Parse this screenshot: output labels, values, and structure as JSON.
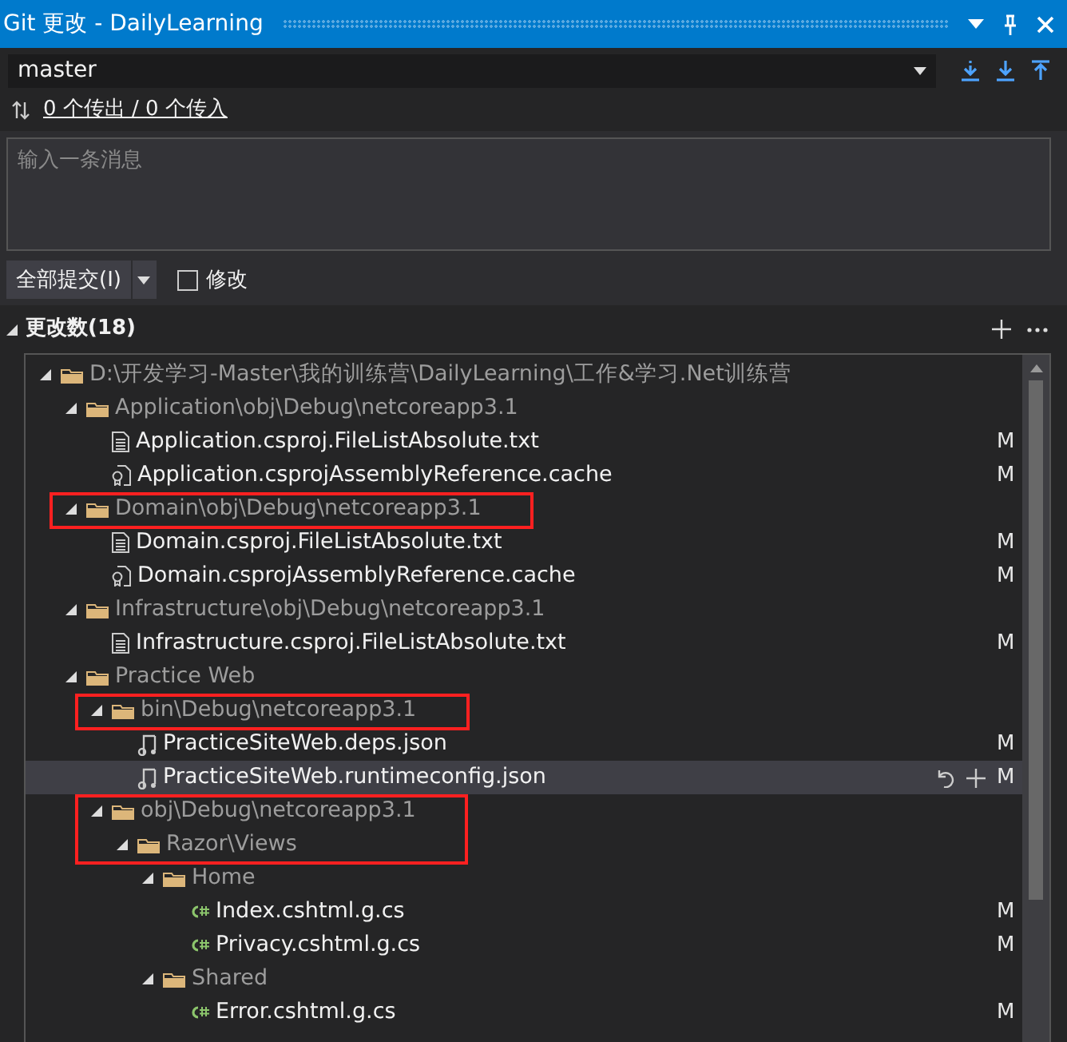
{
  "window": {
    "title": "Git 更改 - DailyLearning"
  },
  "branch": {
    "value": "master"
  },
  "sync": {
    "link": "0 个传出 / 0 个传入"
  },
  "message": {
    "placeholder": "输入一条消息"
  },
  "commit": {
    "button": "全部提交(I)",
    "amend": {
      "label": "修改",
      "checked": false
    }
  },
  "changes": {
    "header": "更改数(18)",
    "expanded": true,
    "tree": [
      {
        "label": "D:\\开发学习-Master\\我的训练营\\DailyLearning\\工作&学习.Net训练营",
        "kind": "folder",
        "expanded": true,
        "children": [
          {
            "label": "Application\\obj\\Debug\\netcoreapp3.1",
            "kind": "folder",
            "expanded": true,
            "children": [
              {
                "label": "Application.csproj.FileListAbsolute.txt",
                "kind": "text",
                "status": "M",
                "selected": false
              },
              {
                "label": "Application.csprojAssemblyReference.cache",
                "kind": "reference",
                "status": "M",
                "selected": false
              }
            ]
          },
          {
            "label": "Domain\\obj\\Debug\\netcoreapp3.1",
            "kind": "folder",
            "expanded": true,
            "highlighted": true,
            "children": [
              {
                "label": "Domain.csproj.FileListAbsolute.txt",
                "kind": "text",
                "status": "M",
                "selected": false
              },
              {
                "label": "Domain.csprojAssemblyReference.cache",
                "kind": "reference",
                "status": "M",
                "selected": false
              }
            ]
          },
          {
            "label": "Infrastructure\\obj\\Debug\\netcoreapp3.1",
            "kind": "folder",
            "expanded": true,
            "children": [
              {
                "label": "Infrastructure.csproj.FileListAbsolute.txt",
                "kind": "text",
                "status": "M",
                "selected": false
              }
            ]
          },
          {
            "label": "Practice Web",
            "kind": "folder",
            "expanded": true,
            "children": [
              {
                "label": "bin\\Debug\\netcoreapp3.1",
                "kind": "folder",
                "expanded": true,
                "highlighted": true,
                "children": [
                  {
                    "label": "PracticeSiteWeb.deps.json",
                    "kind": "json",
                    "status": "M",
                    "selected": false
                  },
                  {
                    "label": "PracticeSiteWeb.runtimeconfig.json",
                    "kind": "json",
                    "status": "M",
                    "selected": true
                  }
                ]
              },
              {
                "label": "obj\\Debug\\netcoreapp3.1",
                "kind": "folder",
                "expanded": true,
                "highlighted": true,
                "children": [
                  {
                    "label": "Razor\\Views",
                    "kind": "folder",
                    "expanded": true,
                    "highlighted": true,
                    "children": [
                      {
                        "label": "Home",
                        "kind": "folder",
                        "expanded": true,
                        "children": [
                          {
                            "label": "Index.cshtml.g.cs",
                            "kind": "csharp",
                            "status": "M",
                            "selected": false
                          },
                          {
                            "label": "Privacy.cshtml.g.cs",
                            "kind": "csharp",
                            "status": "M",
                            "selected": false
                          }
                        ]
                      },
                      {
                        "label": "Shared",
                        "kind": "folder",
                        "expanded": true,
                        "children": [
                          {
                            "label": "Error.cshtml.g.cs",
                            "kind": "csharp",
                            "status": "M",
                            "selected": false
                          }
                        ]
                      }
                    ]
                  }
                ]
              }
            ]
          }
        ]
      }
    ]
  }
}
